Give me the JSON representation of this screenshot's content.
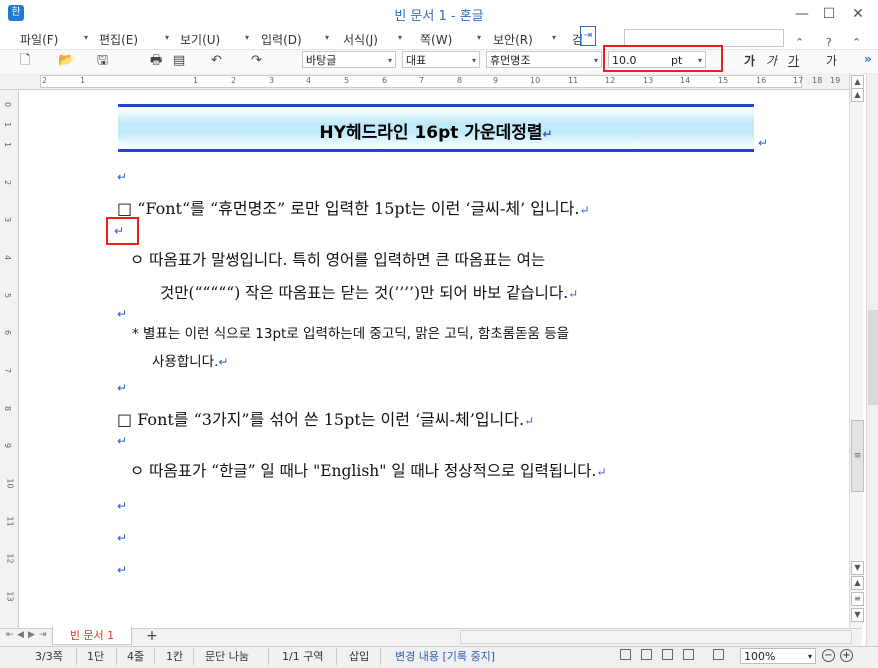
{
  "window": {
    "title": "빈 문서 1 - 혼글",
    "app_icon": "한",
    "minimize": "—",
    "maximize": "☐",
    "close": "✕"
  },
  "menu": {
    "items": [
      "파일(F)",
      "편집(E)",
      "보기(U)",
      "입력(D)",
      "서식(J)",
      "쪽(W)",
      "보안(R)",
      "검"
    ],
    "arrow": "▾",
    "toggle": "⇥",
    "right_icons": {
      "chevron_up": "⌃",
      "help": "?",
      "collapse": "⌃"
    }
  },
  "toolbar": {
    "icons": {
      "new": "🗋",
      "open": "📂",
      "save": "🖫",
      "print": "🖶",
      "preview": "▤",
      "undo": "↶",
      "redo": "↷"
    },
    "style": "바탕글",
    "font_lang": "대표",
    "font_name": "휴먼명조",
    "font_size_value": "10.0",
    "font_size_unit": "pt",
    "format_buttons": [
      "가",
      "가",
      "가",
      "가"
    ],
    "overflow": "»"
  },
  "ruler": {
    "h_numbers": [
      "2",
      "1",
      "1",
      "2",
      "3",
      "4",
      "5",
      "6",
      "7",
      "8",
      "9",
      "10",
      "11",
      "12",
      "13",
      "14",
      "15",
      "16",
      "17",
      "18",
      "19"
    ],
    "v_numbers": [
      "0",
      "1",
      "1",
      "2",
      "3",
      "4",
      "5",
      "6",
      "7",
      "8",
      "9",
      "10",
      "11",
      "12",
      "13",
      "14"
    ]
  },
  "document": {
    "heading": "HY헤드라인 16pt 가운데정렬",
    "para_mark": "↵",
    "lines": [
      "□ “Font“를  “휴먼명조” 로만  입력한  15pt는  이런  ‘글씨-체’ 입니다.",
      "ㅇ   따옴표가  말썽입니다.  특히  영어를  입력하면  큰  따옴표는  여는",
      "것만(“““““)  작은  따옴표는  닫는  것(’’’’)만  되어  바보  같습니다.",
      "* 별표는  이런  식으로  13pt로  입력하는데  중고딕,  맑은  고딕,  함초롬돋움  등을",
      "사용합니다.",
      "□ Font를 “3가지”를  섞어  쓴  15pt는  이런  ‘글씨-체’입니다.",
      "ㅇ   따옴표가  “한글”  일  때나  \"English\"  일  때나  정상적으로  입력됩니다."
    ]
  },
  "tabs": {
    "doc_tab": "빈 문서 1",
    "add_tab": "+",
    "nav": [
      "⇤",
      "◀",
      "▶",
      "⇥"
    ]
  },
  "scrollbar": {
    "up": "▲",
    "down": "▼",
    "grip": "≡"
  },
  "status": {
    "page": "3/3쪽",
    "column": "1단",
    "line": "4줄",
    "col_pos": "1칸",
    "section_break": "문단 나눔",
    "section": "1/1 구역",
    "insert_mode": "삽입",
    "track_changes": "변경 내용 [기록 중지]",
    "zoom": "100%",
    "zoom_out": "−",
    "zoom_in": "+"
  },
  "colors": {
    "accent_blue": "#1f44d6",
    "highlight_red": "#e8211c",
    "para_mark_blue": "#2d5bd6",
    "heading_bg": "#bfe9f7"
  }
}
